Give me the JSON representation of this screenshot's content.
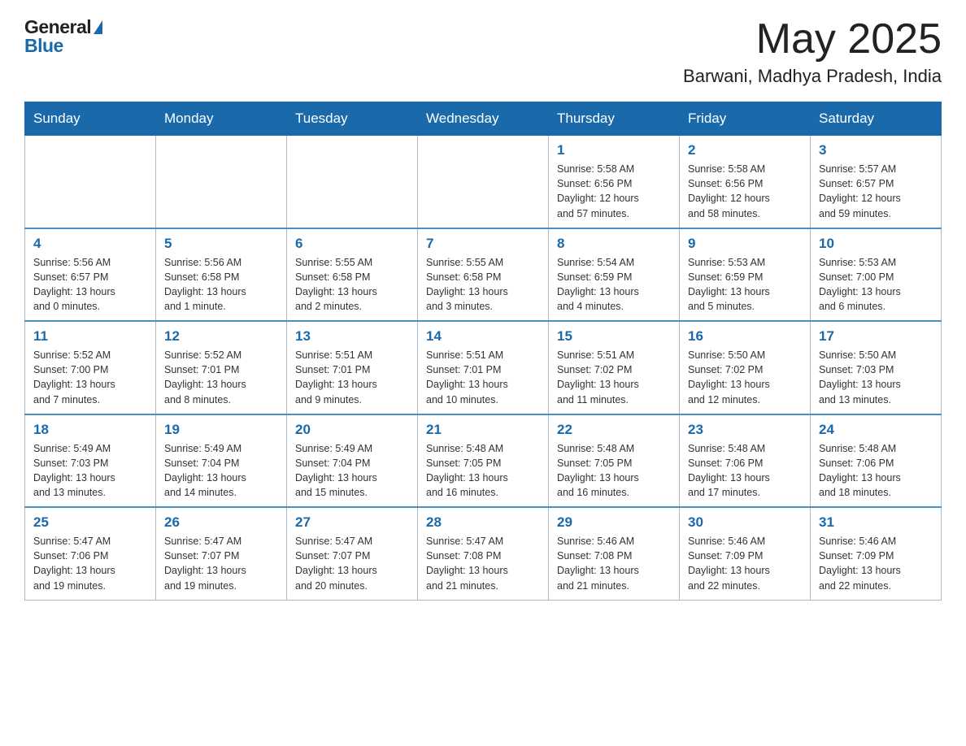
{
  "header": {
    "logo_general": "General",
    "logo_blue": "Blue",
    "month_title": "May 2025",
    "location": "Barwani, Madhya Pradesh, India"
  },
  "days_of_week": [
    "Sunday",
    "Monday",
    "Tuesday",
    "Wednesday",
    "Thursday",
    "Friday",
    "Saturday"
  ],
  "weeks": [
    [
      {
        "day": "",
        "info": ""
      },
      {
        "day": "",
        "info": ""
      },
      {
        "day": "",
        "info": ""
      },
      {
        "day": "",
        "info": ""
      },
      {
        "day": "1",
        "info": "Sunrise: 5:58 AM\nSunset: 6:56 PM\nDaylight: 12 hours\nand 57 minutes."
      },
      {
        "day": "2",
        "info": "Sunrise: 5:58 AM\nSunset: 6:56 PM\nDaylight: 12 hours\nand 58 minutes."
      },
      {
        "day": "3",
        "info": "Sunrise: 5:57 AM\nSunset: 6:57 PM\nDaylight: 12 hours\nand 59 minutes."
      }
    ],
    [
      {
        "day": "4",
        "info": "Sunrise: 5:56 AM\nSunset: 6:57 PM\nDaylight: 13 hours\nand 0 minutes."
      },
      {
        "day": "5",
        "info": "Sunrise: 5:56 AM\nSunset: 6:58 PM\nDaylight: 13 hours\nand 1 minute."
      },
      {
        "day": "6",
        "info": "Sunrise: 5:55 AM\nSunset: 6:58 PM\nDaylight: 13 hours\nand 2 minutes."
      },
      {
        "day": "7",
        "info": "Sunrise: 5:55 AM\nSunset: 6:58 PM\nDaylight: 13 hours\nand 3 minutes."
      },
      {
        "day": "8",
        "info": "Sunrise: 5:54 AM\nSunset: 6:59 PM\nDaylight: 13 hours\nand 4 minutes."
      },
      {
        "day": "9",
        "info": "Sunrise: 5:53 AM\nSunset: 6:59 PM\nDaylight: 13 hours\nand 5 minutes."
      },
      {
        "day": "10",
        "info": "Sunrise: 5:53 AM\nSunset: 7:00 PM\nDaylight: 13 hours\nand 6 minutes."
      }
    ],
    [
      {
        "day": "11",
        "info": "Sunrise: 5:52 AM\nSunset: 7:00 PM\nDaylight: 13 hours\nand 7 minutes."
      },
      {
        "day": "12",
        "info": "Sunrise: 5:52 AM\nSunset: 7:01 PM\nDaylight: 13 hours\nand 8 minutes."
      },
      {
        "day": "13",
        "info": "Sunrise: 5:51 AM\nSunset: 7:01 PM\nDaylight: 13 hours\nand 9 minutes."
      },
      {
        "day": "14",
        "info": "Sunrise: 5:51 AM\nSunset: 7:01 PM\nDaylight: 13 hours\nand 10 minutes."
      },
      {
        "day": "15",
        "info": "Sunrise: 5:51 AM\nSunset: 7:02 PM\nDaylight: 13 hours\nand 11 minutes."
      },
      {
        "day": "16",
        "info": "Sunrise: 5:50 AM\nSunset: 7:02 PM\nDaylight: 13 hours\nand 12 minutes."
      },
      {
        "day": "17",
        "info": "Sunrise: 5:50 AM\nSunset: 7:03 PM\nDaylight: 13 hours\nand 13 minutes."
      }
    ],
    [
      {
        "day": "18",
        "info": "Sunrise: 5:49 AM\nSunset: 7:03 PM\nDaylight: 13 hours\nand 13 minutes."
      },
      {
        "day": "19",
        "info": "Sunrise: 5:49 AM\nSunset: 7:04 PM\nDaylight: 13 hours\nand 14 minutes."
      },
      {
        "day": "20",
        "info": "Sunrise: 5:49 AM\nSunset: 7:04 PM\nDaylight: 13 hours\nand 15 minutes."
      },
      {
        "day": "21",
        "info": "Sunrise: 5:48 AM\nSunset: 7:05 PM\nDaylight: 13 hours\nand 16 minutes."
      },
      {
        "day": "22",
        "info": "Sunrise: 5:48 AM\nSunset: 7:05 PM\nDaylight: 13 hours\nand 16 minutes."
      },
      {
        "day": "23",
        "info": "Sunrise: 5:48 AM\nSunset: 7:06 PM\nDaylight: 13 hours\nand 17 minutes."
      },
      {
        "day": "24",
        "info": "Sunrise: 5:48 AM\nSunset: 7:06 PM\nDaylight: 13 hours\nand 18 minutes."
      }
    ],
    [
      {
        "day": "25",
        "info": "Sunrise: 5:47 AM\nSunset: 7:06 PM\nDaylight: 13 hours\nand 19 minutes."
      },
      {
        "day": "26",
        "info": "Sunrise: 5:47 AM\nSunset: 7:07 PM\nDaylight: 13 hours\nand 19 minutes."
      },
      {
        "day": "27",
        "info": "Sunrise: 5:47 AM\nSunset: 7:07 PM\nDaylight: 13 hours\nand 20 minutes."
      },
      {
        "day": "28",
        "info": "Sunrise: 5:47 AM\nSunset: 7:08 PM\nDaylight: 13 hours\nand 21 minutes."
      },
      {
        "day": "29",
        "info": "Sunrise: 5:46 AM\nSunset: 7:08 PM\nDaylight: 13 hours\nand 21 minutes."
      },
      {
        "day": "30",
        "info": "Sunrise: 5:46 AM\nSunset: 7:09 PM\nDaylight: 13 hours\nand 22 minutes."
      },
      {
        "day": "31",
        "info": "Sunrise: 5:46 AM\nSunset: 7:09 PM\nDaylight: 13 hours\nand 22 minutes."
      }
    ]
  ]
}
